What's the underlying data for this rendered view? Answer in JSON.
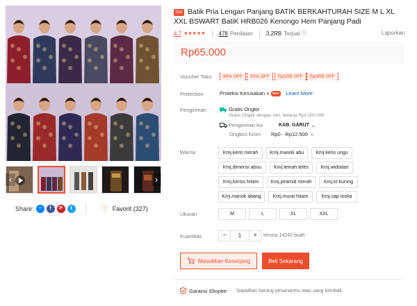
{
  "product": {
    "badge": "Star",
    "title": "Batik Pria Lengan Panjang BATIK BERKAHTURAH SIZE M L XL XXL BSWART BatiK HRB026 Kenongo Hem Panjang Padi",
    "rating": "4.7",
    "reviews_count": "478",
    "reviews_label": "Penilaian",
    "sold_count": "3,2RB",
    "sold_label": "Terjual",
    "report_label": "Laporkan",
    "price": "Rp65.000"
  },
  "gallery": {
    "thumbnail_count": 5,
    "active_thumbnail": 2
  },
  "share": {
    "label": "Share:",
    "favorite_label": "Favorit (327)"
  },
  "voucher": {
    "label": "Voucher Toko",
    "items": [
      "80% OFF",
      "50% OFF",
      "Rp1RB OFF",
      "Rp3RB OFF"
    ]
  },
  "protection": {
    "label": "Protection",
    "text": "Proteksi Kerusakan +",
    "badge": "New",
    "link": "Learn More"
  },
  "shipping": {
    "label": "Pengiriman",
    "free_title": "Gratis Ongkir",
    "free_sub": "Gratis Ongkir dengan min. belanja Rp1.000.000",
    "to_label": "Pengiriman Ke",
    "to_value": "KAB. GARUT",
    "cost_label": "Ongkos Kirim",
    "cost_value": "Rp0 - Rp12.500"
  },
  "variants": {
    "color_label": "Warna",
    "colors": [
      "Kmj.keris merah",
      "Kmj.manok abu",
      "Kmj.keris ungu",
      "Kmj.dimensi abuu",
      "Kmj.lemah teles",
      "Kmj.widodari",
      "Kmj.keriss hitam",
      "Kmj.piramid merah",
      "Kmj.kt kuning",
      "Kmj.manok abang",
      "Kmj.murai hitam",
      "Kmj.cap toska"
    ],
    "size_label": "Ukuran",
    "sizes": [
      "M",
      "L",
      "XL",
      "XXL"
    ]
  },
  "quantity": {
    "label": "Kuantitas",
    "minus": "−",
    "value": "1",
    "plus": "+",
    "stock": "tersisa 14242 buah"
  },
  "actions": {
    "add_to_cart": "Masukkan Keranjang",
    "buy_now": "Beli Sekarang"
  },
  "guarantee": {
    "name": "Garansi Shopee",
    "desc": "Dapatkan barang pesananmu atau uang kembali."
  },
  "colors": {
    "accent": "#ee4d2d",
    "link": "#0055aa"
  }
}
